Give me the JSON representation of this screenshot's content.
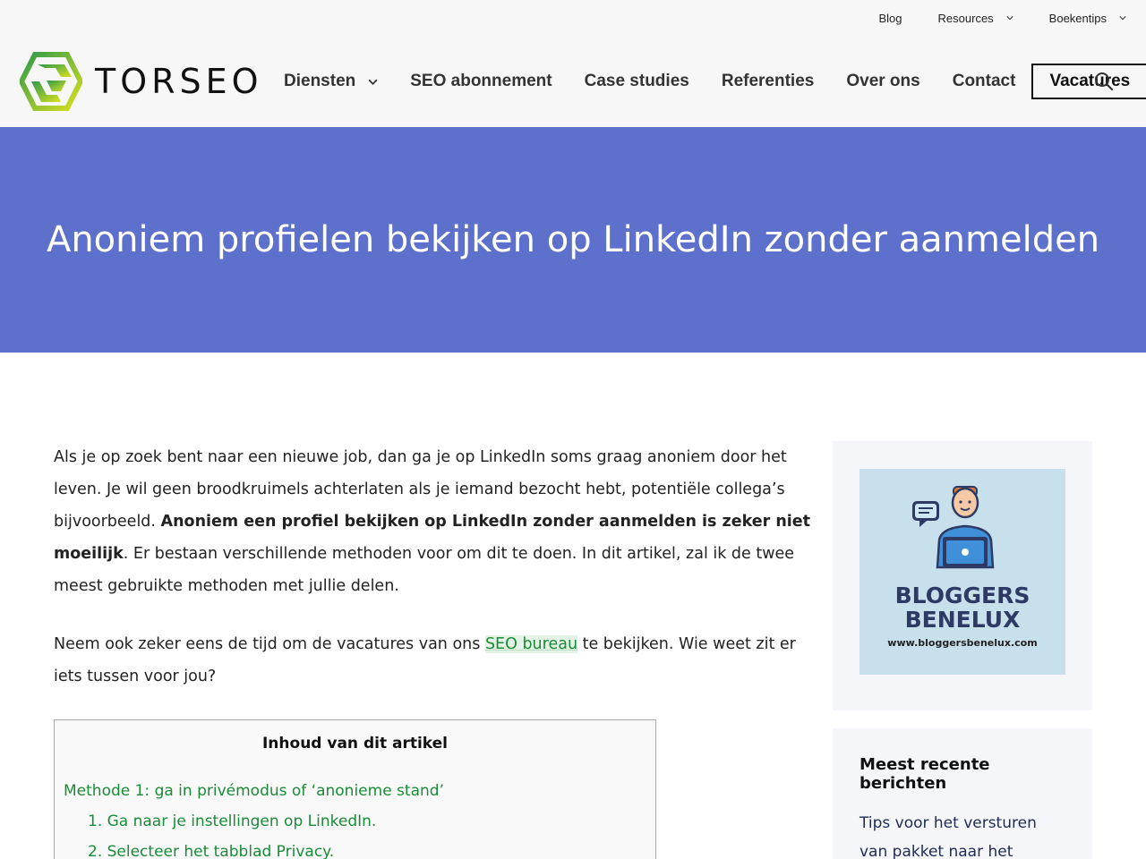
{
  "topbar": {
    "items": [
      {
        "label": "Blog"
      },
      {
        "label": "Resources"
      },
      {
        "label": "Boekentips"
      }
    ]
  },
  "logo": {
    "text": "TORSEO"
  },
  "nav": {
    "items": [
      {
        "label": "Diensten"
      },
      {
        "label": "SEO abonnement"
      },
      {
        "label": "Case studies"
      },
      {
        "label": "Referenties"
      },
      {
        "label": "Over ons"
      },
      {
        "label": "Contact"
      },
      {
        "label": "Vacatures"
      }
    ]
  },
  "hero": {
    "title": "Anoniem profielen bekijken op LinkedIn zonder aanmelden"
  },
  "article": {
    "p1_text": "Als je op zoek bent naar een nieuwe job, dan ga je op LinkedIn soms graag anoniem door het leven. Je wil geen broodkruimels achterlaten als je iemand bezocht hebt, potentiële collega’s bijvoorbeeld. ",
    "p1_bold": "Anoniem een profiel bekijken op LinkedIn zonder aanmelden is zeker niet moeilijk",
    "p1_rest": ". Er bestaan verschillende methoden voor om dit te doen. In dit artikel, zal ik de twee meest gebruikte methoden met jullie delen.",
    "p2_before": " Neem ook zeker eens de tijd om de vacatures van ons ",
    "p2_link": "SEO bureau",
    "p2_after": " te bekijken. Wie weet zit er iets tussen voor jou?"
  },
  "toc": {
    "title": "Inhoud van dit artikel",
    "items": [
      {
        "label": "Methode 1: ga in privémodus of ‘anonieme stand’"
      },
      {
        "label": "1. Ga naar je instellingen op LinkedIn."
      },
      {
        "label": "2. Selecteer het tabblad Privacy."
      }
    ]
  },
  "sidebar": {
    "ad": {
      "title_line1": "BLOGGERS",
      "title_line2": "BENELUX",
      "url": "www.bloggersbenelux.com"
    },
    "recent": {
      "heading": "Meest recente berichten",
      "items": [
        {
          "label": "Tips voor het versturen van pakket naar het buitenland"
        }
      ]
    }
  },
  "colors": {
    "hero_bg": "#5c70cc",
    "link_green": "#1a8b36",
    "header_bg": "#f7f7f7"
  }
}
